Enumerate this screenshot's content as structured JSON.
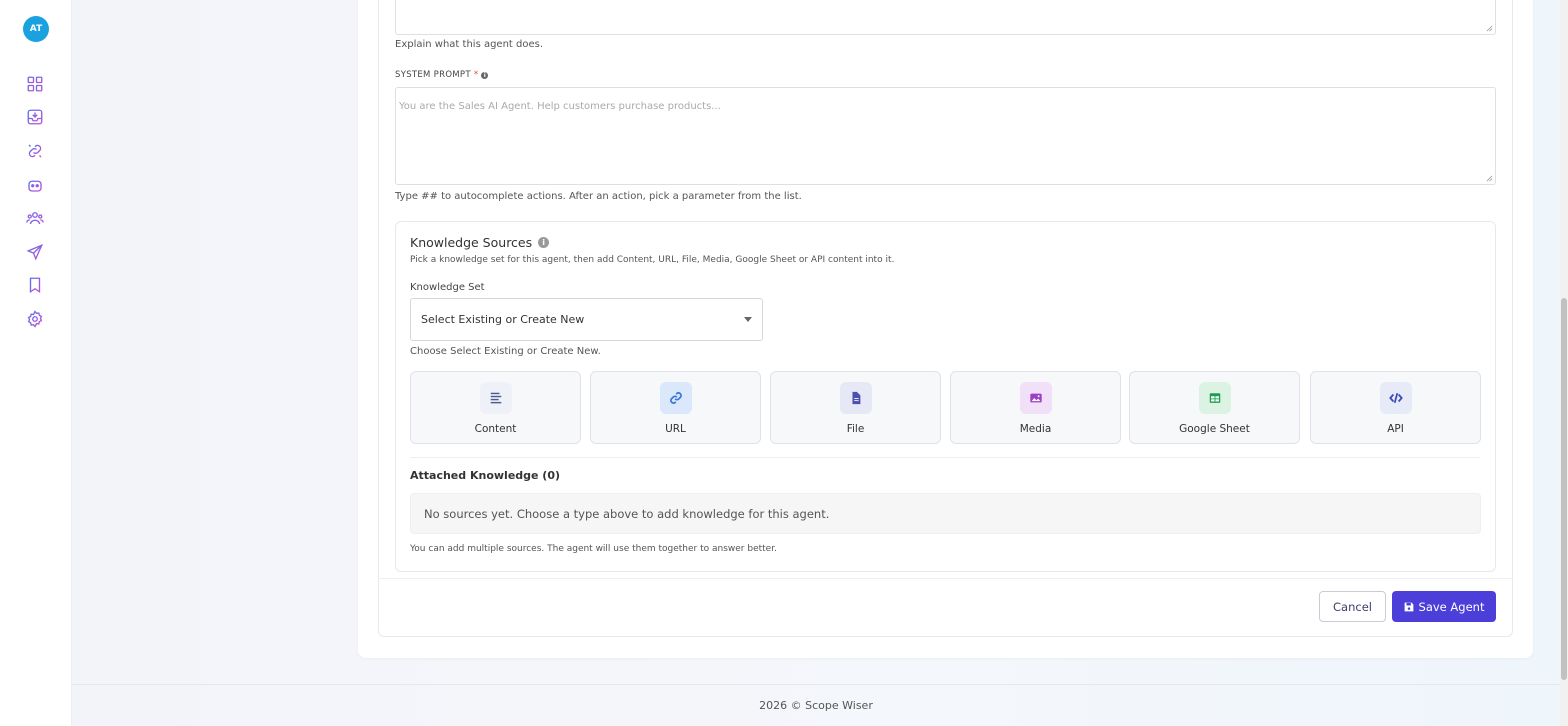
{
  "user": {
    "initials": "AT"
  },
  "sidebar": {
    "items": [
      {
        "icon": "dashboard-grid-icon"
      },
      {
        "icon": "inbox-download-icon"
      },
      {
        "icon": "integrations-link-icon"
      },
      {
        "icon": "bot-icon"
      },
      {
        "icon": "users-group-icon"
      },
      {
        "icon": "send-icon"
      },
      {
        "icon": "bookmark-icon"
      },
      {
        "icon": "settings-gear-icon"
      }
    ]
  },
  "form": {
    "description_hint": "Explain what this agent does.",
    "system_prompt": {
      "label": "SYSTEM PROMPT",
      "required_mark": "*",
      "placeholder": "You are the Sales AI Agent. Help customers purchase products...",
      "hint": "Type ## to autocomplete actions. After an action, pick a parameter from the list."
    },
    "knowledge": {
      "title": "Knowledge Sources",
      "subtitle": "Pick a knowledge set for this agent, then add Content, URL, File, Media, Google Sheet or API content into it.",
      "set_label": "Knowledge Set",
      "select_value": "Select Existing or Create New",
      "select_hint": "Choose Select Existing or Create New.",
      "source_types": [
        {
          "label": "Content",
          "icon": "text-lines-icon",
          "color": "#4a5a8a",
          "bg": "#eef1f7"
        },
        {
          "label": "URL",
          "icon": "link-icon",
          "color": "#3c78d8",
          "bg": "#dbe8fb"
        },
        {
          "label": "File",
          "icon": "file-icon",
          "color": "#4c4fb0",
          "bg": "#e6e8f6"
        },
        {
          "label": "Media",
          "icon": "image-icon",
          "color": "#9b3fc4",
          "bg": "#f1e0f8"
        },
        {
          "label": "Google Sheet",
          "icon": "sheet-table-icon",
          "color": "#1e9c4f",
          "bg": "#dcf3e4"
        },
        {
          "label": "API",
          "icon": "code-icon",
          "color": "#3b49b8",
          "bg": "#e7eaf7"
        }
      ],
      "attached_title": "Attached Knowledge (0)",
      "empty_message": "No sources yet. Choose a type above to add knowledge for this agent.",
      "multi_hint": "You can add multiple sources. The agent will use them together to answer better."
    },
    "actions": {
      "cancel_label": "Cancel",
      "save_label": "Save Agent"
    }
  },
  "footer": {
    "text": "2026 © Scope Wiser"
  },
  "colors": {
    "primary": "#4c3fd9",
    "avatar": "#1aa1e0",
    "icon_gradient_start": "#5b6ff0",
    "icon_gradient_end": "#c04fd6"
  }
}
